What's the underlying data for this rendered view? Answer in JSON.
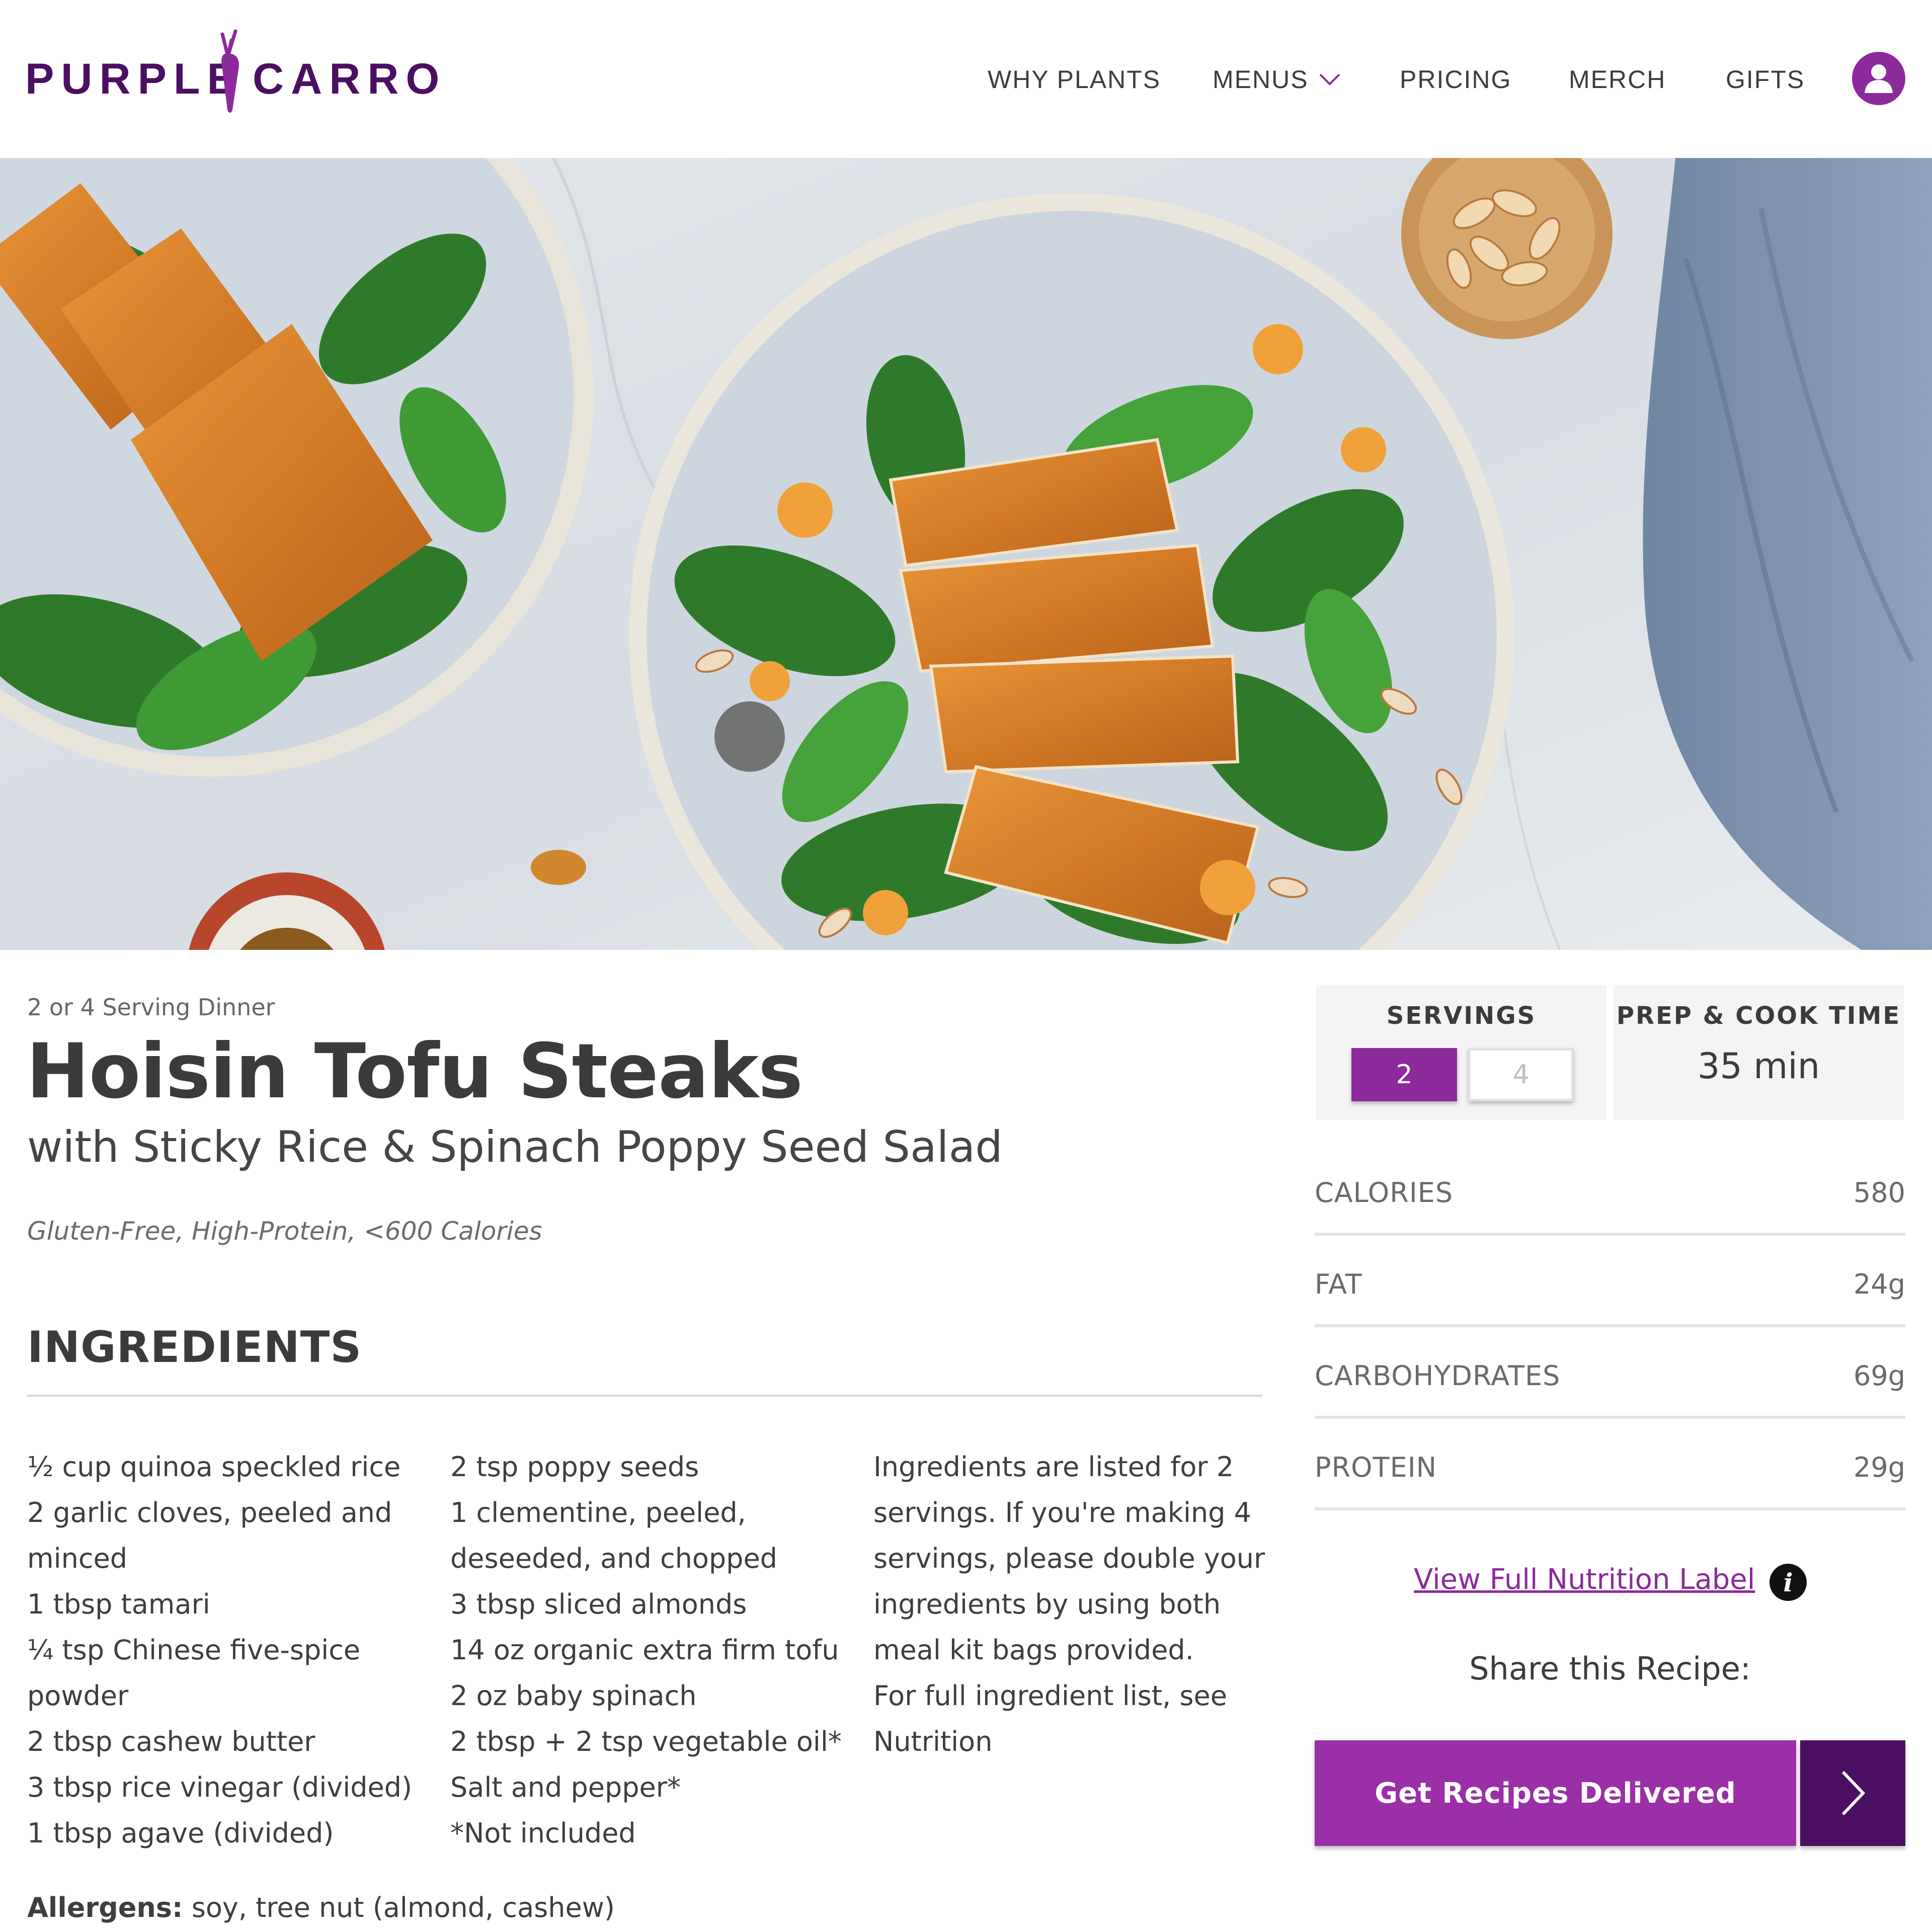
{
  "brand": {
    "left_word": "PURPLE",
    "right_word": "CARROT",
    "color": "#8c2a9c",
    "text_color": "#4b0f62"
  },
  "nav": {
    "why_plants": "WHY PLANTS",
    "menus": "MENUS",
    "pricing": "PRICING",
    "merch": "MERCH",
    "gifts": "GIFTS",
    "account_icon": "user-icon"
  },
  "recipe": {
    "serving_type": "2 or 4 Serving Dinner",
    "title": "Hoisin Tofu Steaks",
    "subtitle": "with Sticky Rice & Spinach Poppy Seed Salad",
    "tags": "Gluten-Free, High-Protein, <600 Calories"
  },
  "ingredients": {
    "heading": "INGREDIENTS",
    "column1": [
      "½ cup quinoa speckled rice",
      "2 garlic cloves, peeled and",
      "minced",
      "1 tbsp tamari",
      "¼ tsp Chinese five-spice",
      "powder",
      "2 tbsp cashew butter",
      "3 tbsp rice vinegar (divided)",
      "1 tbsp agave (divided)"
    ],
    "column2": [
      "2 tsp poppy seeds",
      "1 clementine, peeled,",
      "deseeded, and chopped",
      "3 tbsp sliced almonds",
      "14 oz organic extra firm tofu",
      "2 oz baby spinach",
      "2 tbsp + 2 tsp vegetable oil*",
      "Salt and pepper*",
      "*Not included"
    ],
    "note": [
      "Ingredients are listed for 2",
      "servings. If you're making 4",
      "servings, please double your",
      "ingredients by using both",
      "meal kit bags provided.",
      "For full ingredient list, see",
      "Nutrition"
    ],
    "allergens_label": "Allergens:",
    "allergens": " soy, tree nut (almond, cashew)"
  },
  "servings": {
    "label": "SERVINGS",
    "option_selected": "2",
    "option_other": "4"
  },
  "prep": {
    "label": "PREP & COOK TIME",
    "value": "35 min"
  },
  "nutrition": [
    {
      "label": "CALORIES",
      "value": "580"
    },
    {
      "label": "FAT",
      "value": "24g"
    },
    {
      "label": "CARBOHYDRATES",
      "value": "69g"
    },
    {
      "label": "PROTEIN",
      "value": "29g"
    }
  ],
  "nutrition_link": "View Full Nutrition Label ",
  "info_icon": "i",
  "share_label": "Share this Recipe:",
  "cta": {
    "label": "Get Recipes Delivered",
    "arrow_icon": "chevron-right-icon"
  },
  "colors": {
    "accent": "#8c2a9c",
    "accent_dark": "#4b0f62",
    "cta": "#9b2fa7"
  }
}
